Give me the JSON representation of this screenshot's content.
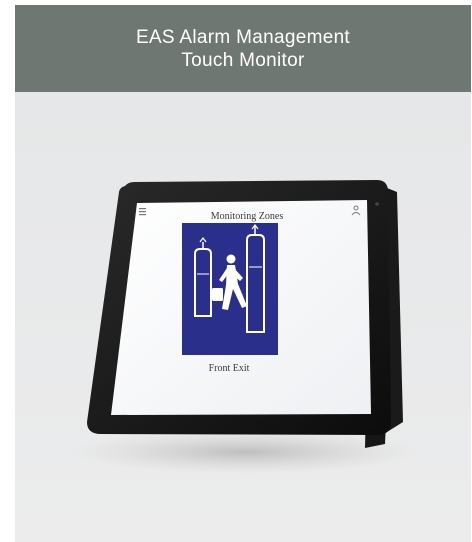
{
  "header": {
    "line1": "EAS Alarm Management",
    "line2": "Touch Monitor"
  },
  "screen": {
    "title": "Monitoring Zones",
    "zone_label": "Front Exit"
  },
  "colors": {
    "header_bg": "#6f7772",
    "zone_tile": "#2b2f8c",
    "accent_strip": "#3fbf8c"
  },
  "icons": [
    "menu-icon",
    "user-icon",
    "walking-person-icon",
    "eas-gate-icon"
  ]
}
